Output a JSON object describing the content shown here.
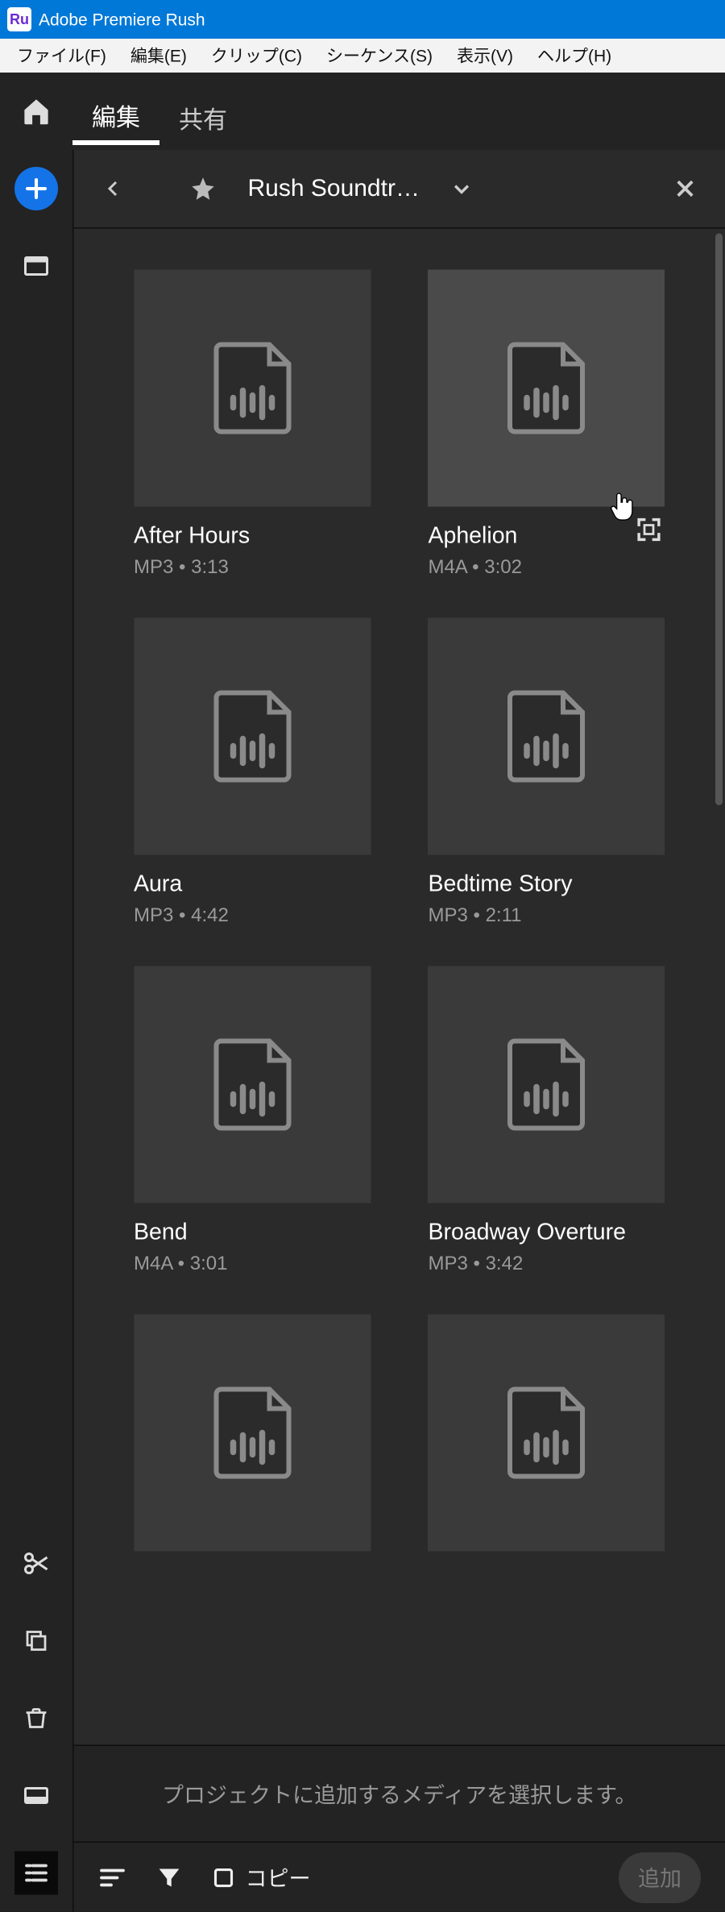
{
  "window": {
    "title": "Adobe Premiere Rush",
    "app_icon_text": "Ru"
  },
  "menubar": {
    "items": [
      {
        "label": "ファイル(F)"
      },
      {
        "label": "編集(E)"
      },
      {
        "label": "クリップ(C)"
      },
      {
        "label": "シーケンス(S)"
      },
      {
        "label": "表示(V)"
      },
      {
        "label": "ヘルプ(H)"
      }
    ]
  },
  "tabs": {
    "edit": "編集",
    "share": "共有"
  },
  "panel": {
    "title": "Rush Soundtr…",
    "hint": "プロジェクトに追加するメディアを選択します。"
  },
  "footer": {
    "copy_label": "コピー",
    "add_label": "追加"
  },
  "assets": [
    {
      "title": "After Hours",
      "format": "MP3",
      "duration": "3:13"
    },
    {
      "title": "Aphelion",
      "format": "M4A",
      "duration": "3:02"
    },
    {
      "title": "Aura",
      "format": "MP3",
      "duration": "4:42"
    },
    {
      "title": "Bedtime Story",
      "format": "MP3",
      "duration": "2:11"
    },
    {
      "title": "Bend",
      "format": "M4A",
      "duration": "3:01"
    },
    {
      "title": "Broadway Overture",
      "format": "MP3",
      "duration": "3:42"
    }
  ],
  "meta_separator": " • "
}
